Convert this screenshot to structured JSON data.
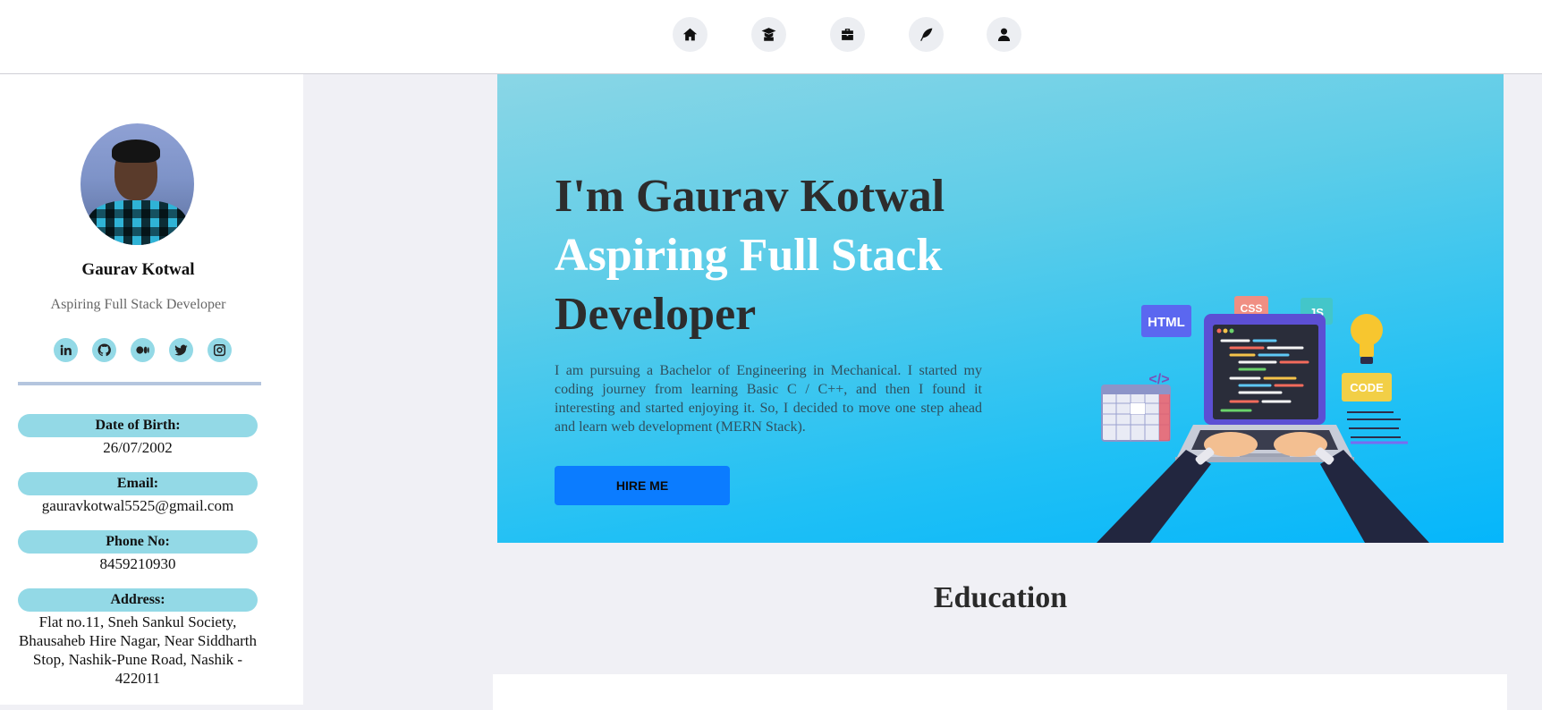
{
  "nav": {
    "items": [
      {
        "icon": "home-icon",
        "label": "Home"
      },
      {
        "icon": "graduation-icon",
        "label": "Education"
      },
      {
        "icon": "briefcase-icon",
        "label": "Projects"
      },
      {
        "icon": "feather-icon",
        "label": "Blog"
      },
      {
        "icon": "user-icon",
        "label": "About"
      }
    ]
  },
  "sidebar": {
    "name": "Gaurav Kotwal",
    "role": "Aspiring Full Stack Developer",
    "socials": [
      "linkedin-icon",
      "github-icon",
      "medium-icon",
      "twitter-icon",
      "instagram-icon"
    ],
    "info": [
      {
        "label": "Date of Birth:",
        "value": "26/07/2002"
      },
      {
        "label": "Email:",
        "value": "gauravkotwal5525@gmail.com"
      },
      {
        "label": "Phone No:",
        "value": "8459210930"
      },
      {
        "label": "Address:",
        "value": "Flat no.11, Sneh Sankul Society, Bhausaheb Hire Nagar, Near Siddharth Stop, Nashik-Pune Road, Nashik - 422011"
      }
    ]
  },
  "hero": {
    "title_line1": "I'm Gaurav Kotwal",
    "title_line2": "Aspiring Full Stack",
    "title_line3": "Developer",
    "description": "I am pursuing a Bachelor of Engineering in Mechanical. I started my coding journey from learning Basic C / C++, and then I found it interesting and started enjoying it. So, I decided to move one step ahead and learn web development (MERN Stack).",
    "button": "HIRE ME",
    "illustration": {
      "html_tag": "HTML",
      "css_tag": "CSS",
      "js_tag": "JS",
      "code_tag": "CODE",
      "bracket_tag": "</>"
    }
  },
  "education": {
    "heading": "Education"
  },
  "colors": {
    "accent": "#93d9e6",
    "button": "#0b7cff",
    "hero_start": "#8ad6e6",
    "hero_end": "#05b6fb"
  }
}
